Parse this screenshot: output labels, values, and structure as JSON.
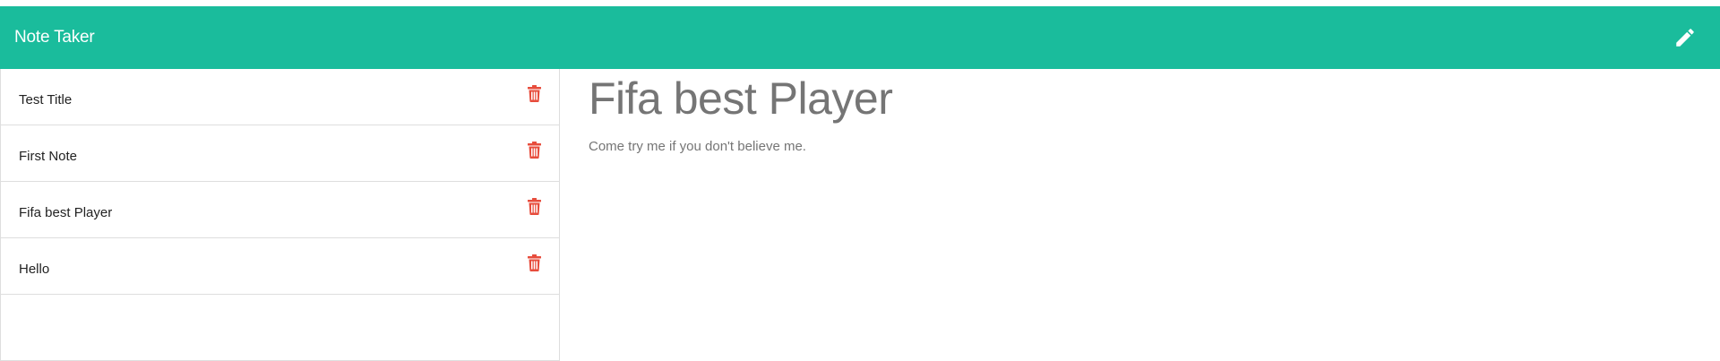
{
  "app": {
    "brand": "Note Taker",
    "accent_color": "#1abc9c",
    "danger_color": "#e74c3c",
    "new_note_icon": "pencil-icon",
    "delete_icon": "trash-icon"
  },
  "sidebar": {
    "notes": [
      {
        "title": "Test Title"
      },
      {
        "title": "First Note"
      },
      {
        "title": "Fifa best Player"
      },
      {
        "title": "Hello"
      }
    ]
  },
  "editor": {
    "title": "Fifa best Player",
    "text": "Come try me if you don't believe me."
  }
}
